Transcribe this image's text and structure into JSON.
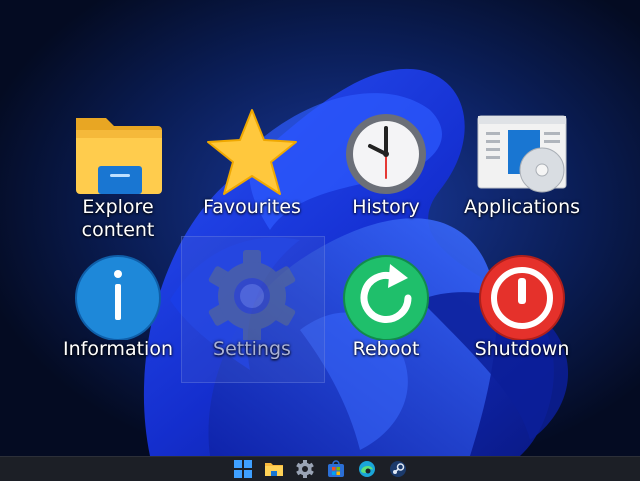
{
  "desktop": {
    "tiles": [
      {
        "label": "Explore\ncontent",
        "icon": "folder-icon"
      },
      {
        "label": "Favourites",
        "icon": "star-icon"
      },
      {
        "label": "History",
        "icon": "clock-icon"
      },
      {
        "label": "Applications",
        "icon": "applications-icon"
      },
      {
        "label": "Information",
        "icon": "info-icon"
      },
      {
        "label": "Settings",
        "icon": "gear-icon",
        "selected": true
      },
      {
        "label": "Reboot",
        "icon": "reboot-icon"
      },
      {
        "label": "Shutdown",
        "icon": "power-icon"
      }
    ]
  },
  "taskbar": {
    "icons": [
      "windows-start-icon",
      "file-explorer-icon",
      "settings-icon",
      "store-icon",
      "edge-icon",
      "steam-icon"
    ]
  },
  "colors": {
    "wallpaper_dark": "#06132f",
    "wallpaper_blue": "#1f3cff",
    "taskbar": "#1c1f26",
    "reboot_green": "#1fbf6b",
    "shutdown_red": "#e5312b",
    "info_blue": "#1e88d9",
    "star_yellow": "#ffc83d"
  }
}
